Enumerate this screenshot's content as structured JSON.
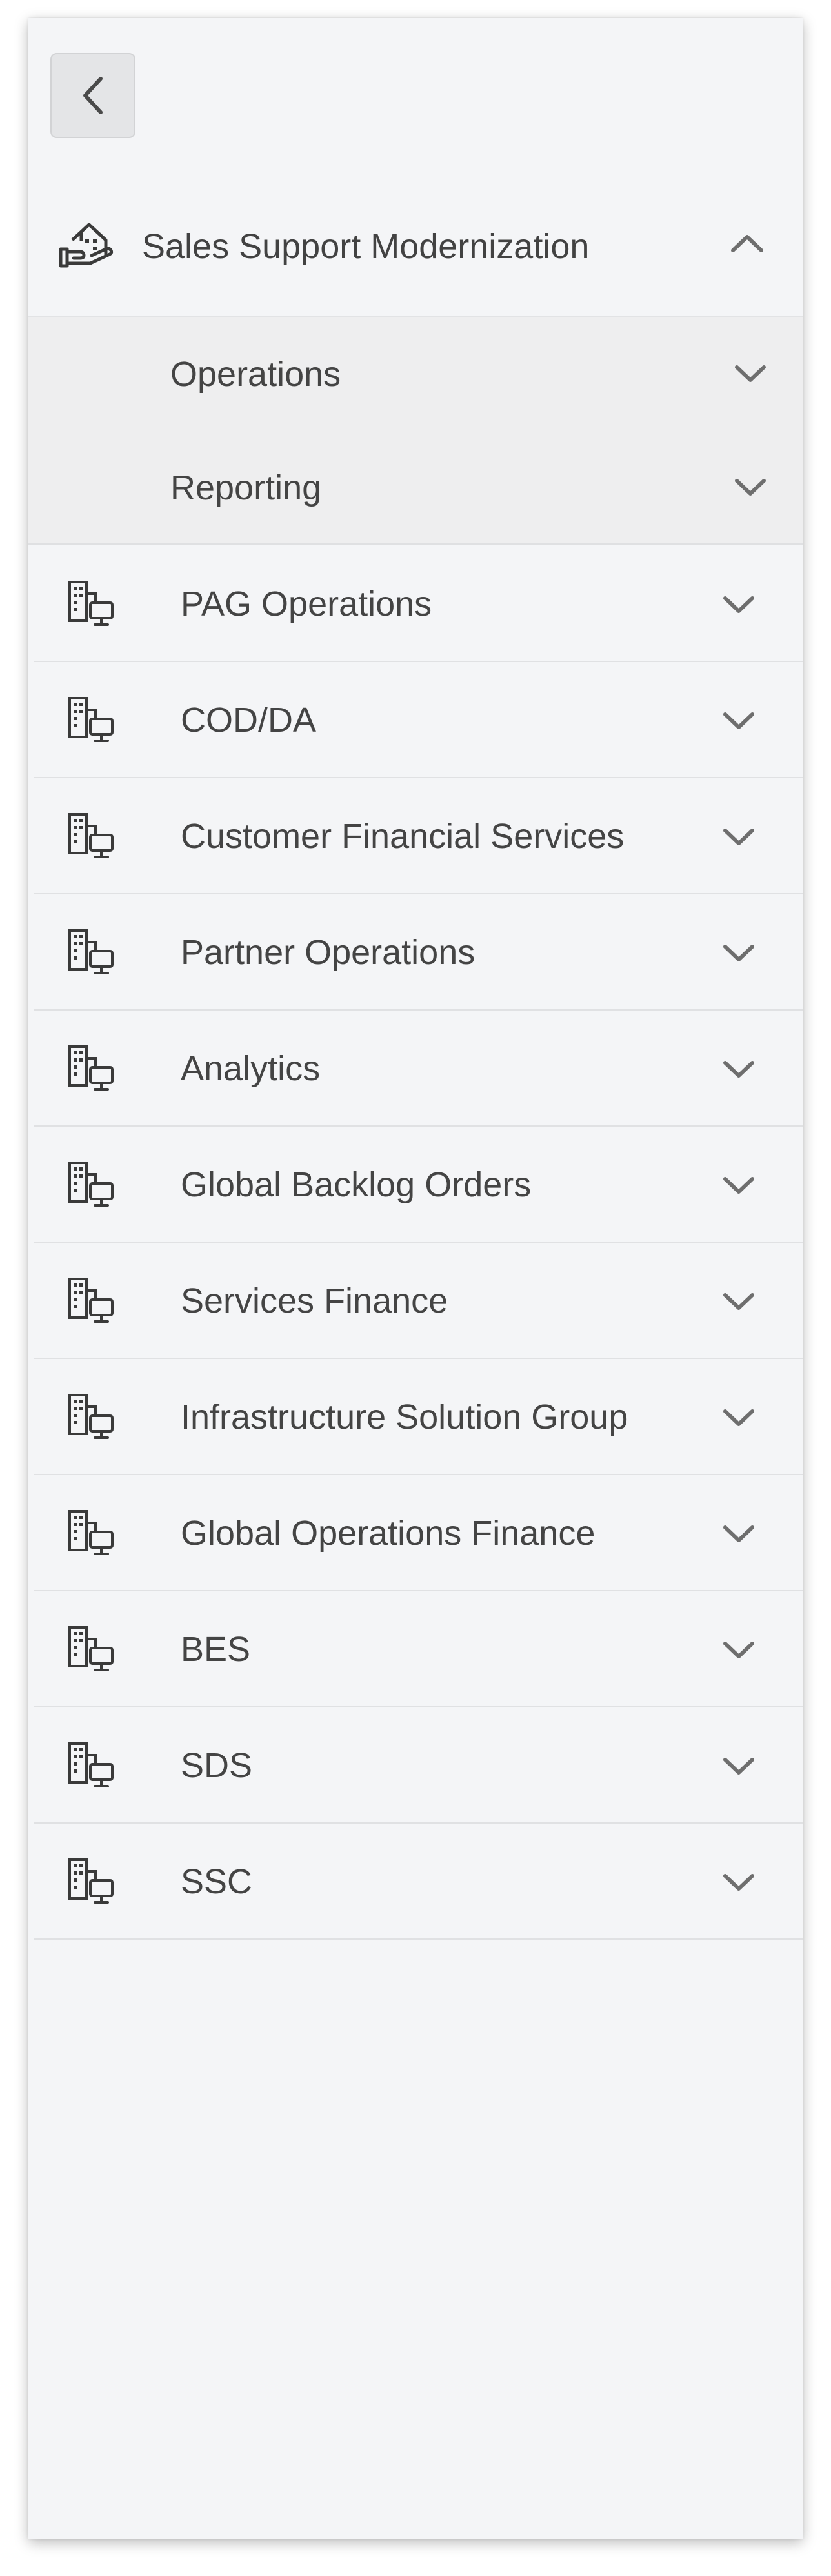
{
  "back_button": {
    "icon": "chevron-left-icon"
  },
  "section": {
    "title": "Sales Support Modernization",
    "icon": "hand-holding-building-icon",
    "expanded": true,
    "sub_items": [
      {
        "label": "Operations"
      },
      {
        "label": "Reporting"
      }
    ]
  },
  "nav": {
    "item_icon": "building-computer-icon",
    "items": [
      {
        "label": "PAG Operations"
      },
      {
        "label": "COD/DA"
      },
      {
        "label": "Customer Financial Services"
      },
      {
        "label": "Partner Operations"
      },
      {
        "label": "Analytics"
      },
      {
        "label": "Global Backlog Orders"
      },
      {
        "label": "Services Finance"
      },
      {
        "label": "Infrastructure Solution Group"
      },
      {
        "label": "Global Operations Finance"
      },
      {
        "label": "BES"
      },
      {
        "label": "SDS"
      },
      {
        "label": "SSC"
      }
    ]
  },
  "colors": {
    "panel_bg": "#f4f5f7",
    "sub_bg": "#eeeeef",
    "text": "#424242",
    "chevron": "#6e6e6e"
  }
}
